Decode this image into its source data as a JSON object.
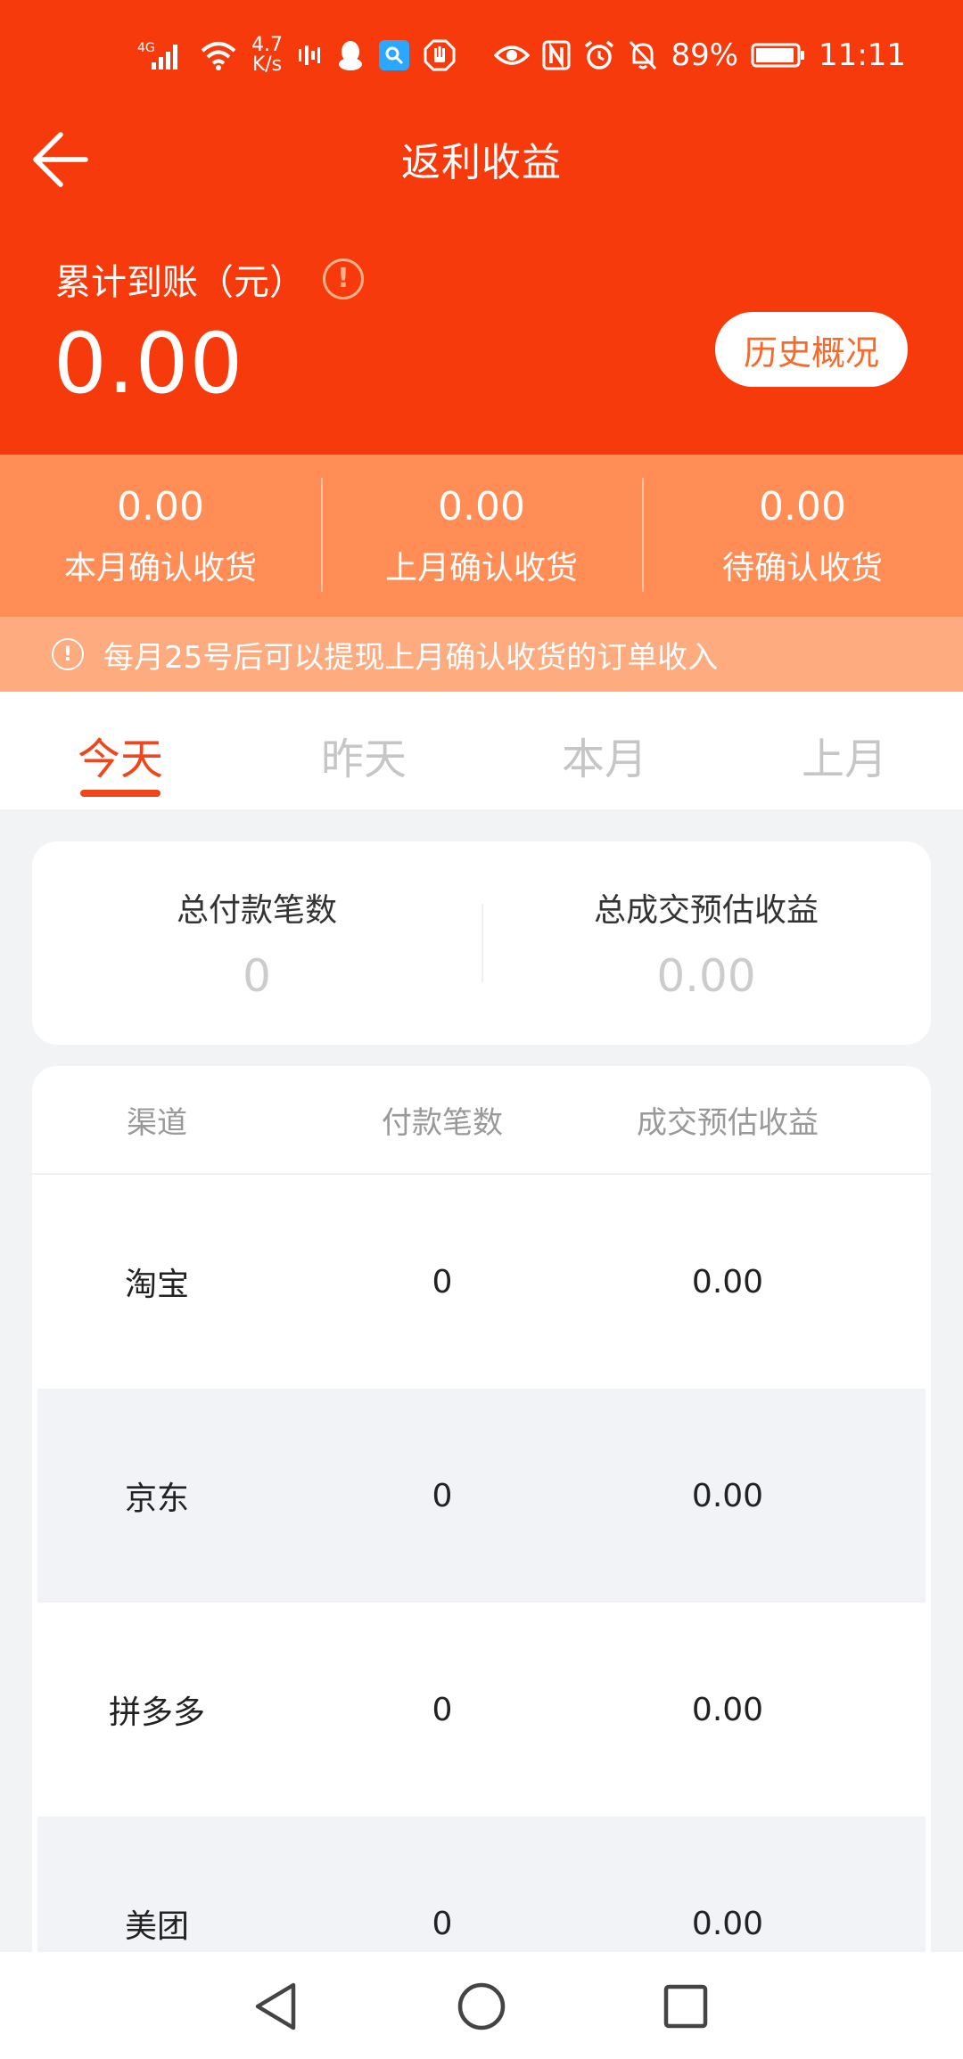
{
  "status_bar": {
    "network": "4G",
    "speed_value": "4.7",
    "speed_unit": "K/s",
    "battery": "89%",
    "time": "11:11"
  },
  "header": {
    "title": "返利收益",
    "cumulative_label": "累计到账（元）",
    "cumulative_amount": "0.00",
    "history_button": "历史概况"
  },
  "stats": [
    {
      "value": "0.00",
      "label": "本月确认收货"
    },
    {
      "value": "0.00",
      "label": "上月确认收货"
    },
    {
      "value": "0.00",
      "label": "待确认收货"
    }
  ],
  "notice": {
    "text": "每月25号后可以提现上月确认收货的订单收入"
  },
  "tabs": [
    {
      "label": "今天",
      "active": true
    },
    {
      "label": "昨天",
      "active": false
    },
    {
      "label": "本月",
      "active": false
    },
    {
      "label": "上月",
      "active": false
    }
  ],
  "summary": {
    "payments_label": "总付款笔数",
    "payments_value": "0",
    "income_label": "总成交预估收益",
    "income_value": "0.00"
  },
  "table": {
    "headers": [
      "渠道",
      "付款笔数",
      "成交预估收益"
    ],
    "rows": [
      {
        "channel": "淘宝",
        "count": "0",
        "income": "0.00"
      },
      {
        "channel": "京东",
        "count": "0",
        "income": "0.00"
      },
      {
        "channel": "拼多多",
        "count": "0",
        "income": "0.00"
      },
      {
        "channel": "美团",
        "count": "0",
        "income": "0.00"
      }
    ]
  },
  "colors": {
    "primary": "#f73a0b",
    "stats_bg": "#ff8d55",
    "notice_bg": "#ffab80",
    "tab_active": "#f1461c"
  },
  "icons": {
    "back": "arrow-left-icon",
    "info": "info-circle-icon",
    "nav_back": "triangle-back-icon",
    "nav_home": "circle-home-icon",
    "nav_recents": "square-recents-icon"
  }
}
